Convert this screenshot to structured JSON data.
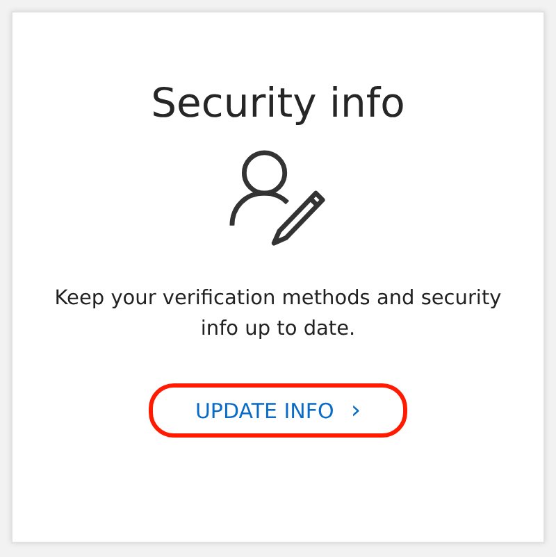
{
  "card": {
    "title": "Security info",
    "description": "Keep your verification methods and security info up to date.",
    "button": {
      "label": "UPDATE INFO",
      "chevron": "›",
      "highlighted": true
    }
  }
}
